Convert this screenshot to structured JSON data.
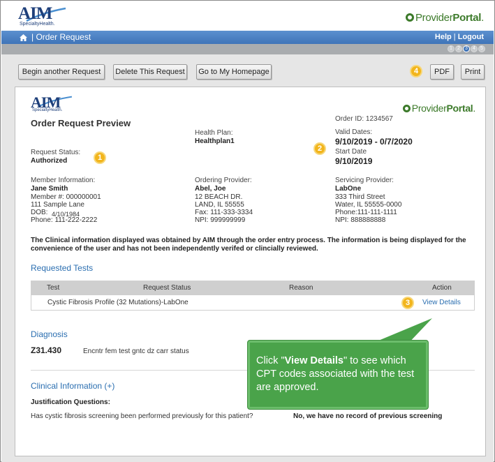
{
  "header": {
    "brand_aim": "AIM",
    "brand_aim_sub": "SpecialtyHealth.",
    "brand_portal_regular": "Provider",
    "brand_portal_bold": "Portal",
    "brand_portal_dot": ".",
    "page_title": "| Order Request",
    "help_link": "Help",
    "separator": " | ",
    "logout_link": "Logout",
    "steps": [
      "1",
      "2",
      "3",
      "4",
      "5"
    ],
    "active_step": 3
  },
  "toolbar": {
    "begin_another": "Begin another Request",
    "delete_request": "Delete This Request",
    "go_home": "Go to My Homepage",
    "pdf": "PDF",
    "print": "Print"
  },
  "badges": {
    "b1": "1",
    "b2": "2",
    "b3": "3",
    "b4": "4"
  },
  "preview": {
    "heading": "Order Request Preview",
    "order_id": "Order ID: 1234567",
    "health_plan_label": "Health Plan:",
    "health_plan_value": "Healthplan1",
    "valid_dates_label": "Valid Dates:",
    "valid_dates_value": "9/10/2019 - 0/7/2020",
    "start_date_label": "Start Date",
    "start_date_value": "9/10/2019",
    "request_status_label": "Request Status:",
    "request_status_value": "Authorized",
    "member": {
      "label": "Member Information:",
      "name": "Jane Smith",
      "member_no": "Member #: 000000001",
      "address": "111 Sample Lane",
      "dob_label": "DOB:",
      "dob_value": "4/10/1984",
      "phone": "Phone: 111-222-2222"
    },
    "ordering": {
      "label": "Ordering Provider:",
      "name": "Abel, Joe",
      "address1": "12 BEACH DR.",
      "address2": "LAND, IL 55555",
      "fax": "Fax: 111-333-3334",
      "npi": "NPI: 999999999"
    },
    "servicing": {
      "label": "Servicing Provider:",
      "name": "LabOne",
      "address1": "333 Third Street",
      "address2": "Water, IL 55555-0000",
      "phone": "Phone:111-111-1111",
      "npi": "NPI: 888888888"
    },
    "disclaimer": "The Clinical information displayed was obtained by AIM through the order entry process. The information is being displayed for the convenience of the user and has not been independently verifed or clincially reviewed."
  },
  "requested_tests": {
    "title": "Requested Tests",
    "columns": [
      "Test",
      "Request Status",
      "Reason",
      "Action"
    ],
    "rows": [
      {
        "test": "Cystic Fibrosis Profile (32 Mutations)-LabOne",
        "status": "",
        "reason": "",
        "action": "View Details"
      }
    ]
  },
  "diagnosis": {
    "title": "Diagnosis",
    "code": "Z31.430",
    "description": "Encntr fem test gntc dz carr status"
  },
  "clinical": {
    "title": "Clinical Information (+)",
    "justification_label": "Justification Questions:",
    "question": "Has cystic fibrosis screening been performed previously for this patient?",
    "answer": "No, we have no record of previous screening"
  },
  "callout": {
    "prefix": "Click \"",
    "bold": "View Details",
    "suffix": "\" to see which CPT codes associated with the test are approved."
  },
  "colors": {
    "brand_blue": "#3f74b8",
    "portal_green": "#3c7a2a",
    "link_blue": "#2a6eb0",
    "badge_yellow": "#f2b51c",
    "callout_green": "#4aa34a"
  }
}
